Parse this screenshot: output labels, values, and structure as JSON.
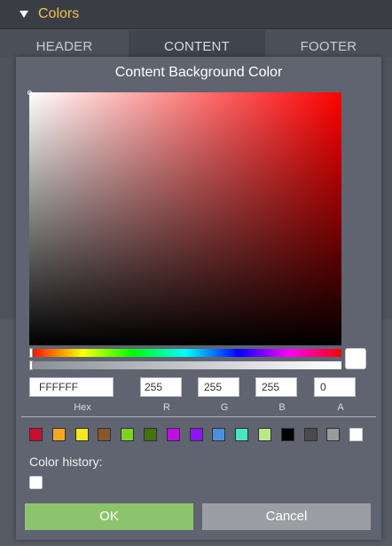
{
  "section": {
    "title": "Colors",
    "icon": "triangle-down-icon"
  },
  "tabs": [
    {
      "label": "HEADER"
    },
    {
      "label": "CONTENT"
    },
    {
      "label": "FOOTER"
    }
  ],
  "dialog": {
    "title": "Content Background Color",
    "hex": {
      "value": "FFFFFF",
      "label": "Hex"
    },
    "r": {
      "value": "255",
      "label": "R"
    },
    "g": {
      "value": "255",
      "label": "G"
    },
    "b": {
      "value": "255",
      "label": "B"
    },
    "a": {
      "value": "0",
      "label": "A"
    },
    "hue_position": 0,
    "alpha_position": 0,
    "preview_color": "#ffffff",
    "swatches": [
      "#c8102e",
      "#f5a623",
      "#f8e71c",
      "#8b572a",
      "#7ed321",
      "#417505",
      "#bd10e0",
      "#9013fe",
      "#4a90e2",
      "#50e3c2",
      "#b8e986",
      "#000000",
      "#4a4a4a",
      "#9b9b9b",
      "#ffffff"
    ],
    "history_label": "Color history:",
    "history": [
      "#ffffff"
    ],
    "ok_label": "OK",
    "cancel_label": "Cancel"
  },
  "colors": {
    "accent": "#f2c14e",
    "ok": "#8cc46e",
    "cancel": "#9c9ea3"
  }
}
